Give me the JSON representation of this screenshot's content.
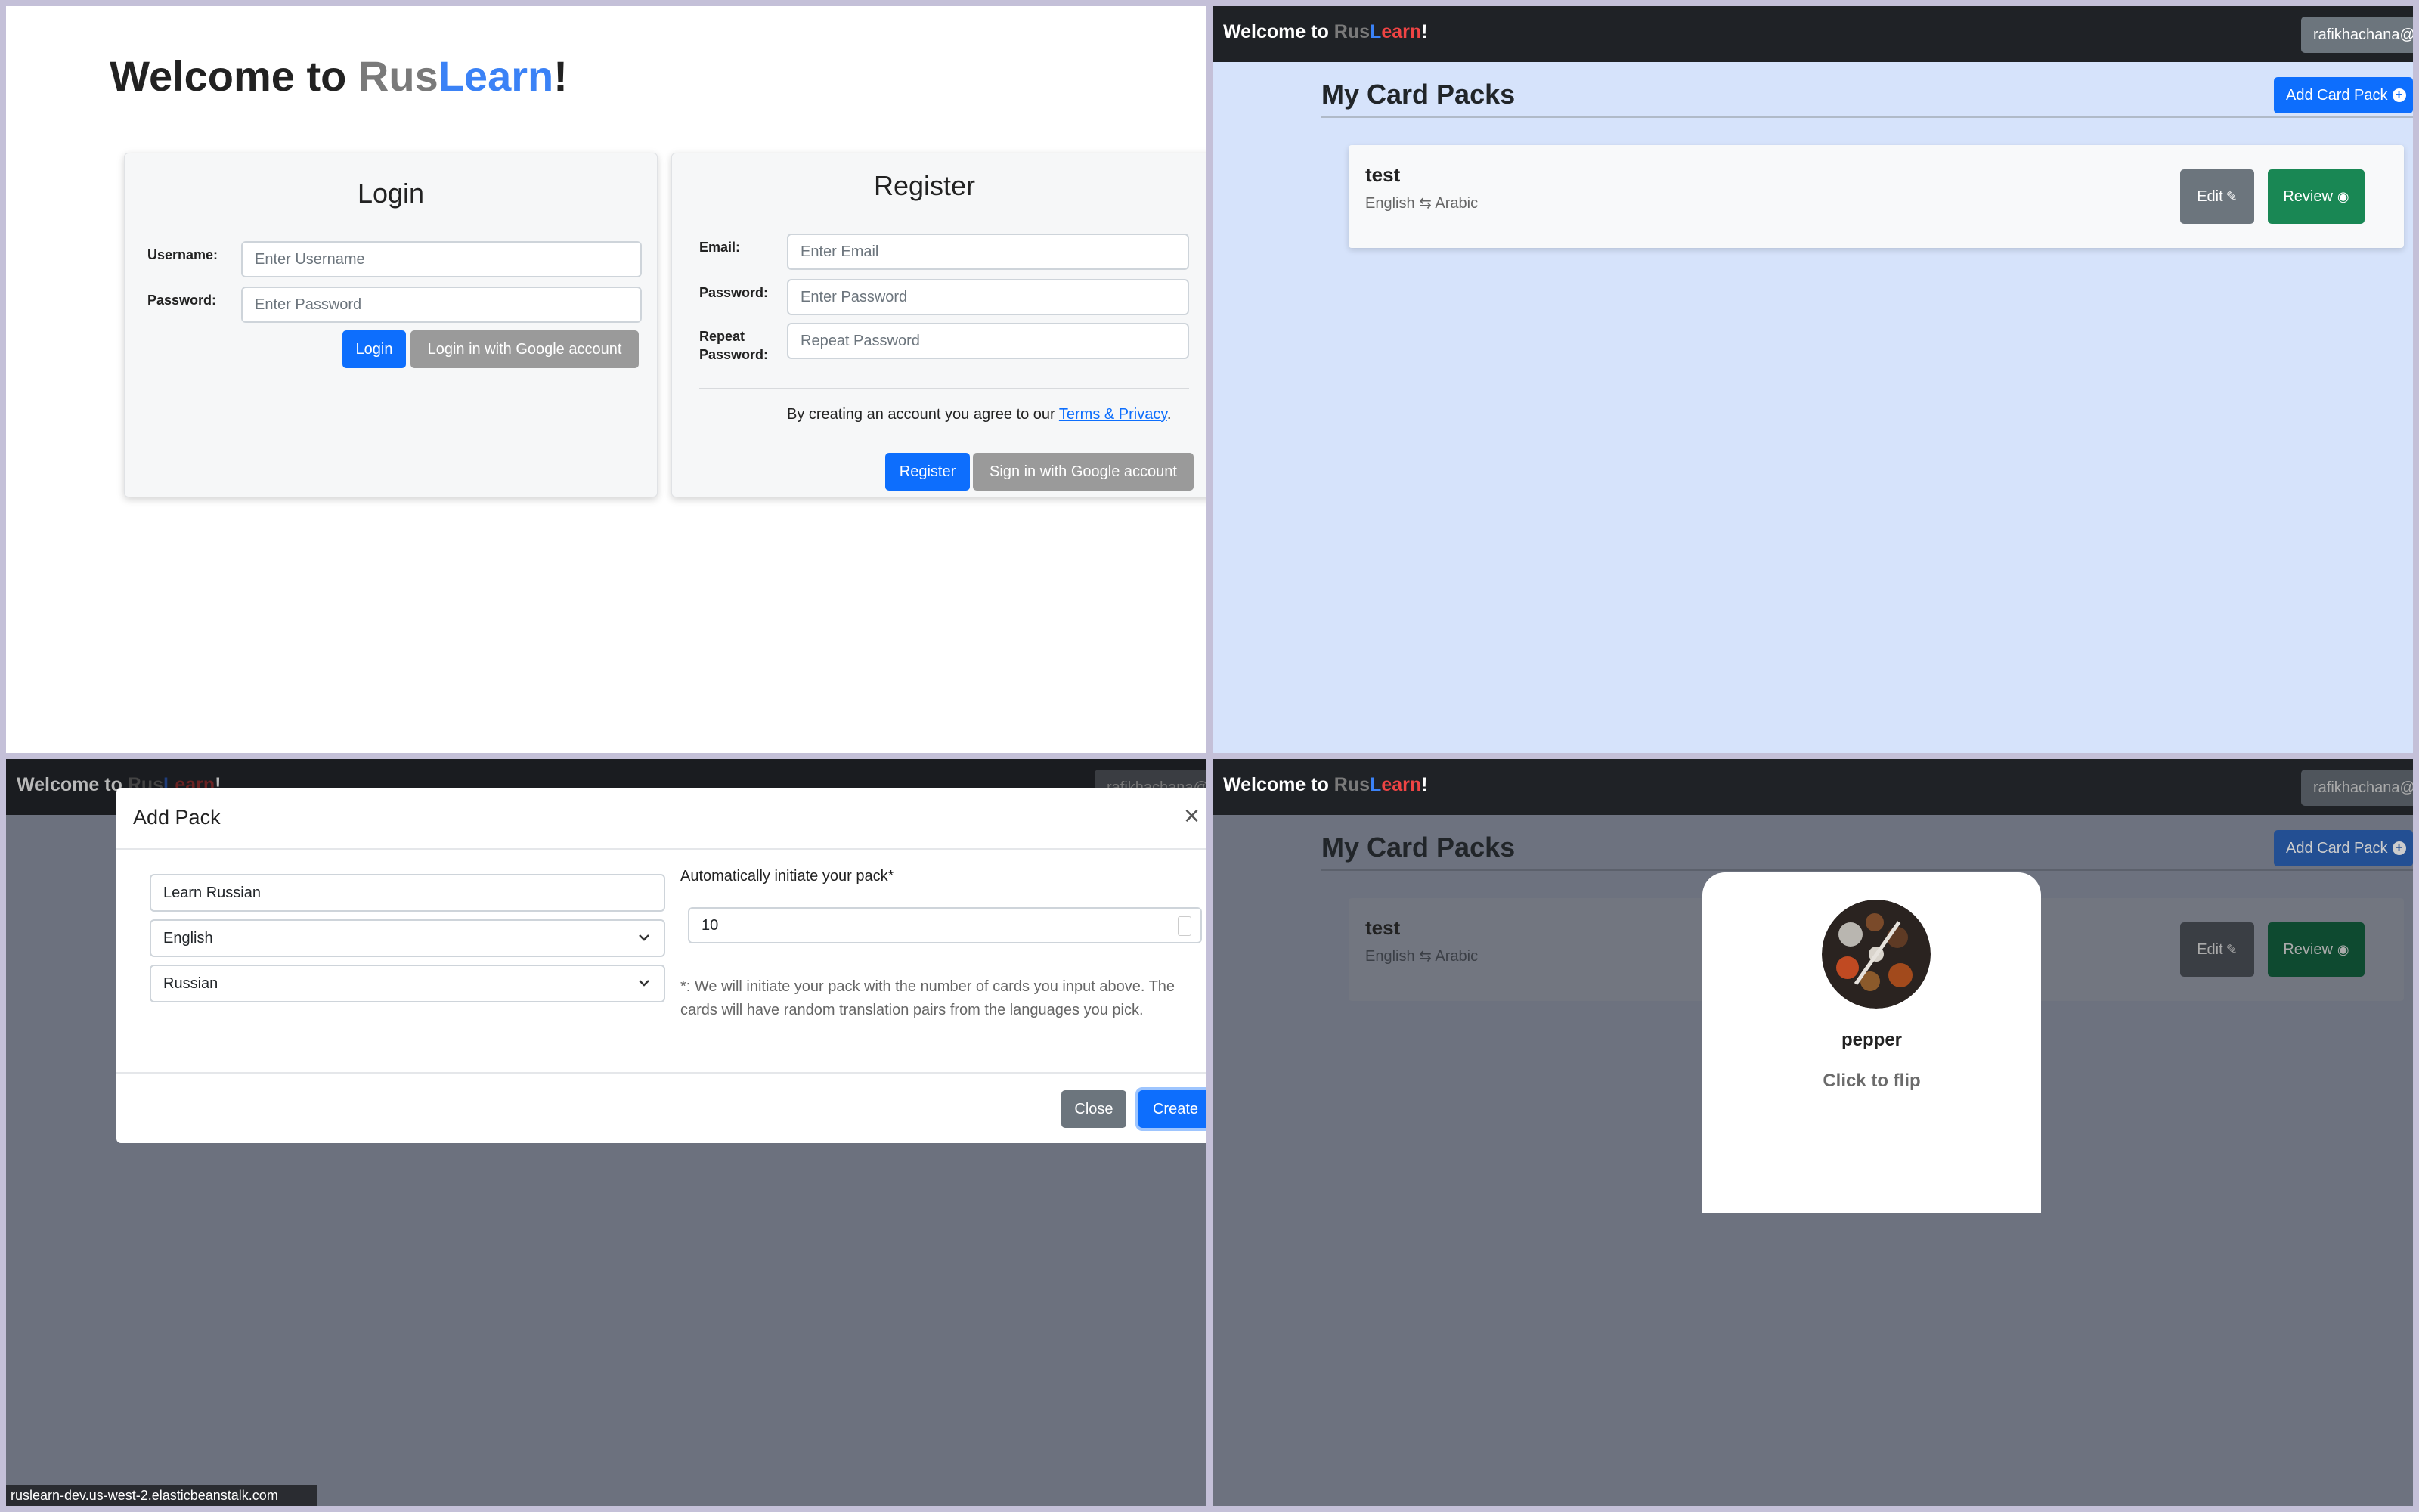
{
  "brand": {
    "prefix": "Welcome to ",
    "rus": "Rus",
    "learn_l": "L",
    "learn_rest": "earn",
    "suffix": "!"
  },
  "auth_page": {
    "title_prefix": "Welcome to ",
    "title_rus": "Rus",
    "title_learn": "Learn",
    "title_suffix": "!",
    "login": {
      "heading": "Login",
      "username_label": "Username:",
      "username_placeholder": "Enter Username",
      "password_label": "Password:",
      "password_placeholder": "Enter Password",
      "login_button": "Login",
      "google_button": "Login in with Google account"
    },
    "register": {
      "heading": "Register",
      "email_label": "Email:",
      "email_placeholder": "Enter Email",
      "password_label": "Password:",
      "password_placeholder": "Enter Password",
      "repeat_label_1": "Repeat",
      "repeat_label_2": "Password:",
      "repeat_placeholder": "Repeat Password",
      "terms_text": "By creating an account you agree to our ",
      "terms_link": "Terms & Privacy",
      "terms_end": ".",
      "register_button": "Register",
      "google_button": "Sign in with Google account"
    }
  },
  "navbar": {
    "user": "rafikhachana@"
  },
  "packs_page": {
    "title": "My Card Packs",
    "add_button": "Add Card Pack",
    "packs": [
      {
        "name": "test",
        "from": "English",
        "to": "Arabic",
        "edit": "Edit",
        "review": "Review"
      }
    ]
  },
  "add_pack_modal": {
    "title": "Add Pack",
    "pack_name_value": "Learn Russian",
    "source_language": "English",
    "target_language": "Russian",
    "auto_label": "Automatically initiate your pack*",
    "card_count": "10",
    "note": "*: We will initiate your pack with the number of cards you input above. The cards will have random translation pairs from the languages you pick.",
    "close_button": "Close",
    "create_button": "Create"
  },
  "status_url": "ruslearn-dev.us-west-2.elasticbeanstalk.com",
  "flashcard": {
    "word": "pepper",
    "hint": "Click to flip"
  },
  "colors": {
    "primary": "#0d6efd",
    "secondary": "#6c757d",
    "success": "#198754",
    "navbar": "#1f2226"
  }
}
